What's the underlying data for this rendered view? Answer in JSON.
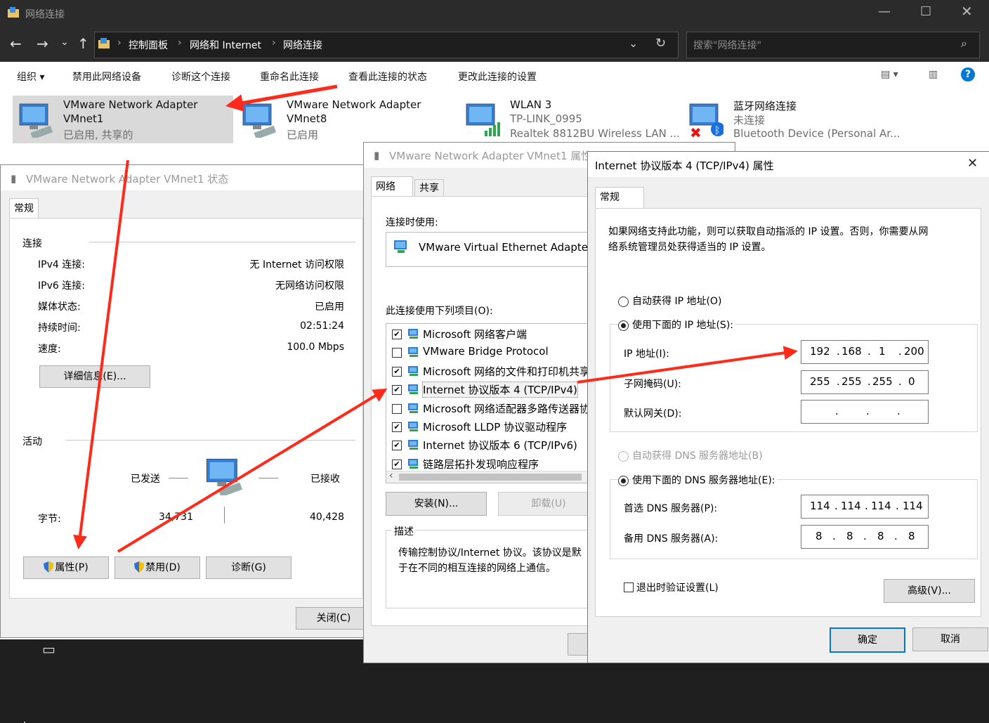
{
  "explorer": {
    "title": "网络连接",
    "breadcrumb": [
      "控制面板",
      "网络和 Internet",
      "网络连接"
    ],
    "search_placeholder": "搜索\"网络连接\"",
    "toolbar": [
      "组织 ▾",
      "禁用此网络设备",
      "诊断这个连接",
      "重命名此连接",
      "查看此连接的状态",
      "更改此连接的设置"
    ],
    "adapters": [
      {
        "name": "VMware Network Adapter",
        "name2": "VMnet1",
        "status": "已启用, 共享的"
      },
      {
        "name": "VMware Network Adapter",
        "name2": "VMnet8",
        "status": "已启用"
      },
      {
        "name": "WLAN 3",
        "name2": "TP-LINK_0995",
        "status": "Realtek 8812BU Wireless LAN ..."
      },
      {
        "name": "蓝牙网络连接",
        "name2": "未连接",
        "status": "Bluetooth Device (Personal Ar..."
      }
    ]
  },
  "status_dialog": {
    "title": "VMware Network Adapter VMnet1 状态",
    "tab": "常规",
    "connection_header": "连接",
    "rows": [
      {
        "label": "IPv4 连接:",
        "value": "无 Internet 访问权限"
      },
      {
        "label": "IPv6 连接:",
        "value": "无网络访问权限"
      },
      {
        "label": "媒体状态:",
        "value": "已启用"
      },
      {
        "label": "持续时间:",
        "value": "02:51:24"
      },
      {
        "label": "速度:",
        "value": "100.0 Mbps"
      }
    ],
    "details_button": "详细信息(E)...",
    "activity_header": "活动",
    "sent_label": "已发送",
    "received_label": "已接收",
    "bytes_label": "字节:",
    "bytes_sent": "34,731",
    "bytes_received": "40,428",
    "properties_button": "属性(P)",
    "disable_button": "禁用(D)",
    "diagnose_button": "诊断(G)",
    "close_button": "关闭(C)"
  },
  "props_dialog": {
    "title": "VMware Network Adapter VMnet1 属性",
    "tabs": [
      "网络",
      "共享"
    ],
    "connect_using_label": "连接时使用:",
    "adapter_name": "VMware Virtual Ethernet Adapter",
    "items_label": "此连接使用下列项目(O):",
    "items": [
      {
        "checked": "✔",
        "text": "Microsoft 网络客户端"
      },
      {
        "checked": "",
        "text": "VMware Bridge Protocol"
      },
      {
        "checked": "✔",
        "text": "Microsoft 网络的文件和打印机共享"
      },
      {
        "checked": "✔",
        "text": "Internet 协议版本 4 (TCP/IPv4)"
      },
      {
        "checked": "",
        "text": "Microsoft 网络适配器多路传送器协议"
      },
      {
        "checked": "✔",
        "text": "Microsoft LLDP 协议驱动程序"
      },
      {
        "checked": "✔",
        "text": "Internet 协议版本 6 (TCP/IPv6)"
      },
      {
        "checked": "✔",
        "text": "链路层拓扑发现响应程序"
      }
    ],
    "install_button": "安装(N)...",
    "uninstall_button": "卸载(U)",
    "desc_header": "描述",
    "description": "传输控制协议/Internet 协议。该协议是默认的广域网络协议，用于在不同的相互连接的网络上通信。",
    "desc_line1": "传输控制协议/Internet 协议。该协议是默",
    "desc_line2": "于在不同的相互连接的网络上通信。"
  },
  "ipv4_dialog": {
    "title": "Internet 协议版本 4 (TCP/IPv4) 属性",
    "tab": "常规",
    "intro_line1": "如果网络支持此功能，则可以获取自动指派的 IP 设置。否则，你需要从网",
    "intro_line2": "络系统管理员处获得适当的 IP 设置。",
    "auto_ip": "自动获得 IP 地址(O)",
    "manual_ip": "使用下面的 IP 地址(S):",
    "ip_label": "IP 地址(I):",
    "ip": [
      "192",
      "168",
      "1",
      "200"
    ],
    "mask_label": "子网掩码(U):",
    "mask": [
      "255",
      "255",
      "255",
      "0"
    ],
    "gateway_label": "默认网关(D):",
    "gateway": [
      "",
      "",
      "",
      ""
    ],
    "auto_dns": "自动获得 DNS 服务器地址(B)",
    "manual_dns": "使用下面的 DNS 服务器地址(E):",
    "dns1_label": "首选 DNS 服务器(P):",
    "dns1": [
      "114",
      "114",
      "114",
      "114"
    ],
    "dns2_label": "备用 DNS 服务器(A):",
    "dns2": [
      "8",
      "8",
      "8",
      "8"
    ],
    "validate": "退出时验证设置(L)",
    "advanced_button": "高级(V)...",
    "ok_button": "确定",
    "cancel_button": "取消"
  },
  "colors": {
    "accent": "#0078d7",
    "arrow": "#ff2a1a",
    "selected": "#cce8ff"
  }
}
